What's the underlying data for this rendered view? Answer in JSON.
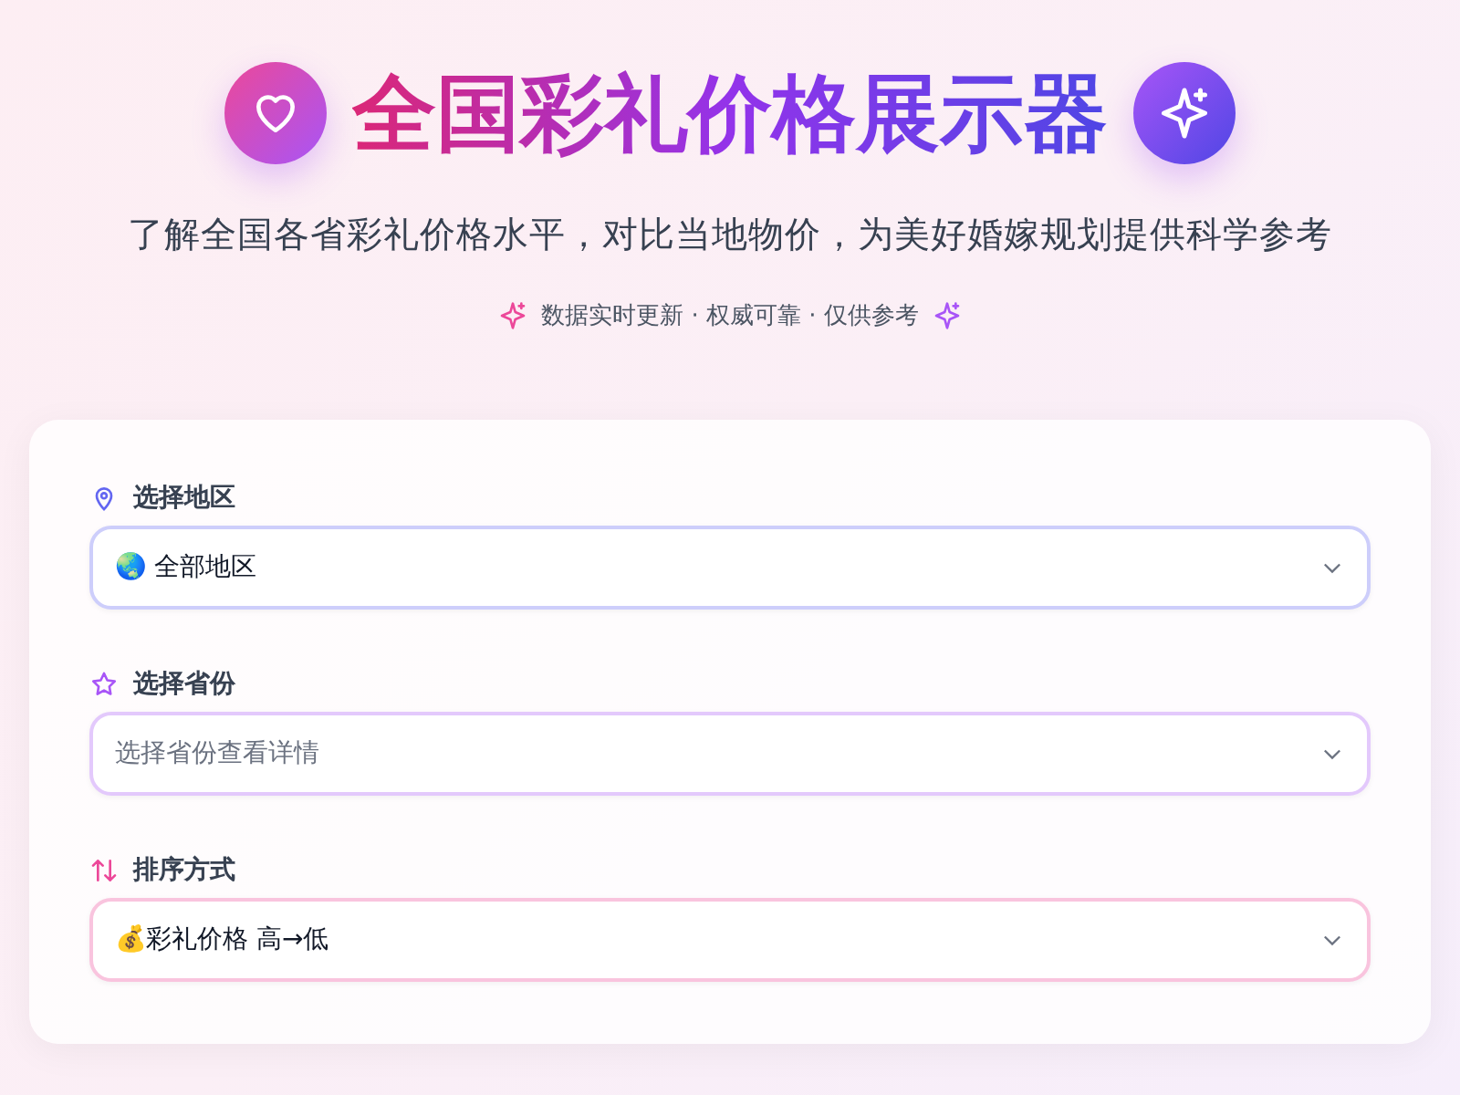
{
  "header": {
    "title": "全国彩礼价格展示器",
    "subtitle": "了解全国各省彩礼价格水平，对比当地物价，为美好婚嫁规划提供科学参考",
    "tagline": "数据实时更新 · 权威可靠 · 仅供参考"
  },
  "filters": [
    {
      "label": "选择地区",
      "color": "#6366f1",
      "value": "🌏 全部地区"
    },
    {
      "label": "选择省份",
      "color": "#a855f7",
      "placeholder": "选择省份查看详情"
    },
    {
      "label": "排序方式",
      "color": "#ec4899",
      "value": "💰彩礼价格 高→低"
    }
  ]
}
